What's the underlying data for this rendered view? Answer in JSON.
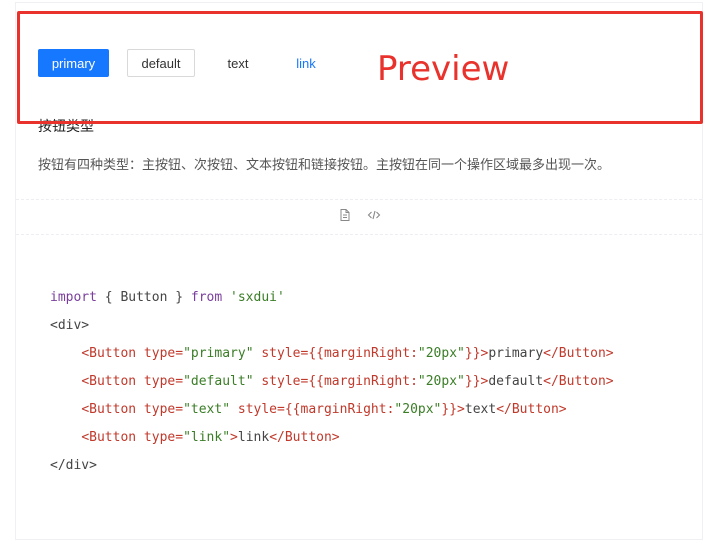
{
  "annotation": {
    "label": "Preview",
    "color": "#e8322b"
  },
  "buttons": {
    "primary": "primary",
    "default": "default",
    "text": "text",
    "link": "link"
  },
  "colors": {
    "primary": "#1677ff",
    "border": "#d9d9d9"
  },
  "demo": {
    "title": "按钮类型",
    "description": "按钮有四种类型：主按钮、次按钮、文本按钮和链接按钮。主按钮在同一个操作区域最多出现一次。"
  },
  "actions": {
    "icons": [
      "file-icon",
      "code-icon"
    ]
  },
  "code": {
    "import_kw": "import",
    "import_body": " { Button } ",
    "from_kw": "from",
    "module": " 'sxdui'",
    "div_open": "<div>",
    "div_close": "</div>",
    "lines": [
      {
        "open": "<Button",
        "attr1": " type=",
        "val1": "\"primary\"",
        "attr2": " style=",
        "val2": "{{marginRight:",
        "val3": "\"20px\"",
        "val4": "}}",
        "close_open": ">",
        "content": "primary",
        "close": "</Button>"
      },
      {
        "open": "<Button",
        "attr1": " type=",
        "val1": "\"default\"",
        "attr2": " style=",
        "val2": "{{marginRight:",
        "val3": "\"20px\"",
        "val4": "}}",
        "close_open": ">",
        "content": "default",
        "close": "</Button>"
      },
      {
        "open": "<Button",
        "attr1": " type=",
        "val1": "\"text\"",
        "attr2": " style=",
        "val2": "{{marginRight:",
        "val3": "\"20px\"",
        "val4": "}}",
        "close_open": ">",
        "content": "text",
        "close": "</Button>"
      },
      {
        "open": "<Button",
        "attr1": " type=",
        "val1": "\"link\"",
        "close_open": ">",
        "content": "link",
        "close": "</Button>"
      }
    ]
  }
}
